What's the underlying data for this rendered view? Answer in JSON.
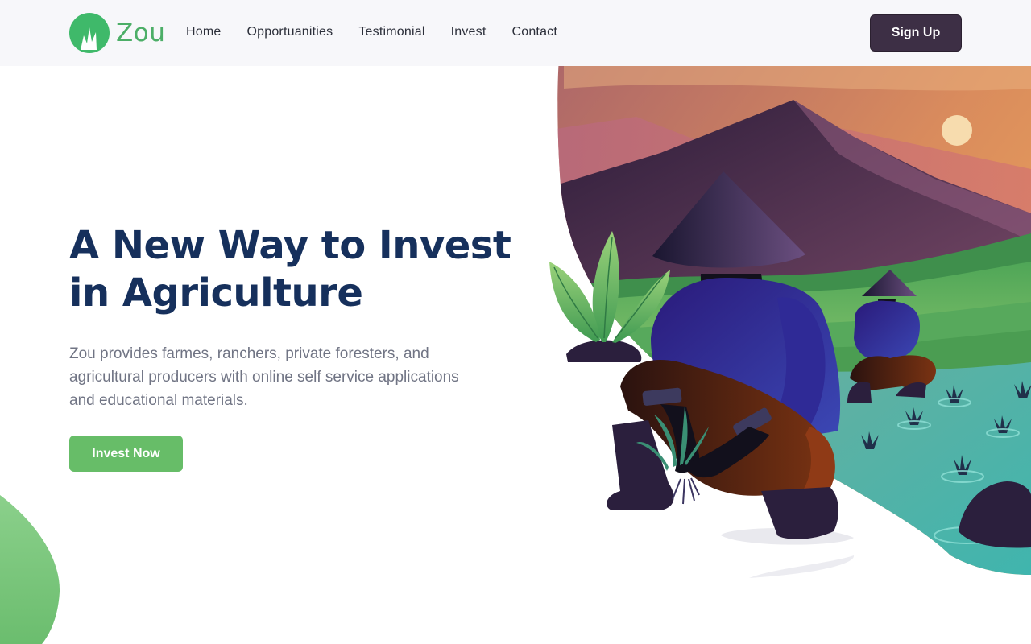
{
  "brand": {
    "name": "Zou",
    "logo_icon": "grass-sprout-icon",
    "accent_color": "#4cae67"
  },
  "nav": {
    "items": [
      {
        "label": "Home"
      },
      {
        "label": "Opportuanities"
      },
      {
        "label": "Testimonial"
      },
      {
        "label": "Invest"
      },
      {
        "label": "Contact"
      }
    ]
  },
  "header": {
    "signup_label": "Sign Up",
    "signup_color": "#3d2f45"
  },
  "hero": {
    "title_line1": "A New Way to Invest",
    "title_line2": "in Agriculture",
    "description": "Zou provides farmes, ranchers, private foresters, and agricultural producers with online self service applications and educational materials.",
    "cta_label": "Invest Now",
    "cta_color": "#67bd68",
    "title_color": "#16305c"
  },
  "illustration": {
    "subject": "farmers-planting-rice-illustration"
  }
}
